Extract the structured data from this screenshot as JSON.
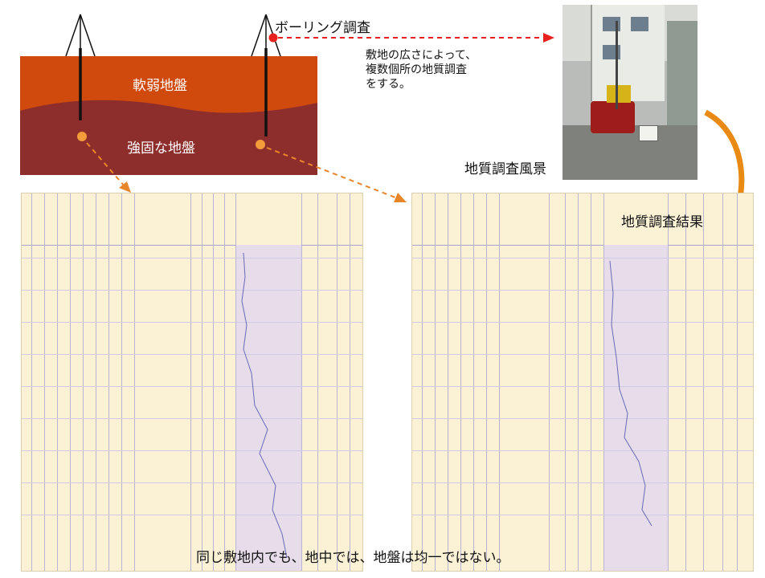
{
  "ground": {
    "soft_layer_label": "軟弱地盤",
    "hard_layer_label": "強固な地盤",
    "colors": {
      "soft": "#cf4a0c",
      "hard": "#8e2e2c",
      "rod": "#111111",
      "arrow_red": "#e8211f",
      "arrow_orange": "#e8862a",
      "dot_orange": "#f39c3b"
    }
  },
  "callouts": {
    "boring_title": "ボーリング調査",
    "boring_note_lines": [
      "敷地の広さによって、",
      "複数個所の地質調査",
      "をする。"
    ],
    "photo_caption": "地質調査風景",
    "result_caption": "地質調査結果"
  },
  "footer": {
    "caption": "同じ敷地内でも、地中では、地盤は均一ではない。"
  }
}
